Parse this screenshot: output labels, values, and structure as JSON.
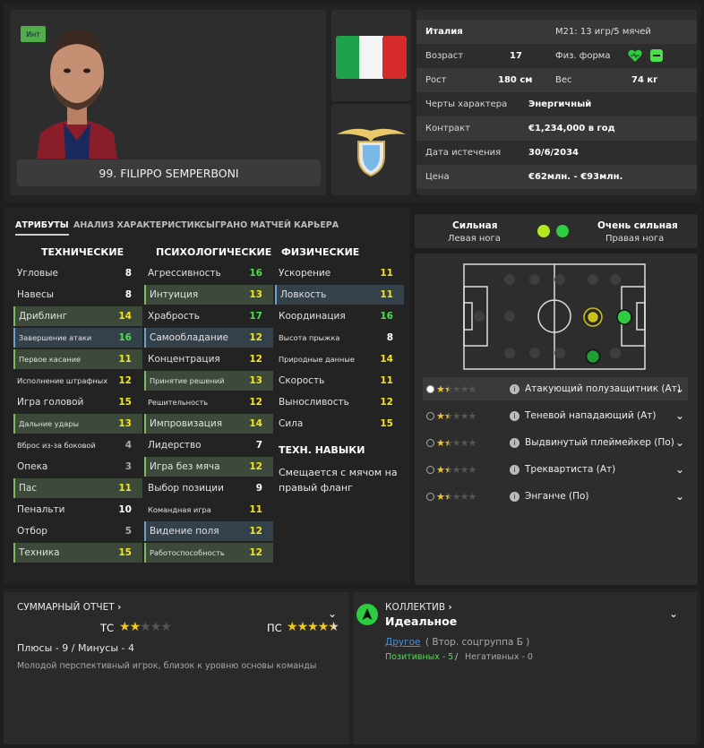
{
  "player": {
    "badge": "Инт",
    "name": "99. FILIPPO SEMPERBONI"
  },
  "info": {
    "nation": "Италия",
    "u21": "М21: 13 игр/5 мячей",
    "age_label": "Возраст",
    "age": "17",
    "fitness_label": "Физ. форма",
    "height_label": "Рост",
    "height": "180 см",
    "weight_label": "Вес",
    "weight": "74 кг",
    "trait_label": "Черты характера",
    "trait": "Энергичный",
    "contract_label": "Контракт",
    "contract": "€1,234,000 в год",
    "expiry_label": "Дата истечения",
    "expiry": "30/6/2034",
    "price_label": "Цена",
    "price": "€62млн. - €93млн."
  },
  "tabs": [
    "АТРИБУТЫ",
    "АНАЛИЗ ХАРАКТЕРИСТИК",
    "СЫГРАНО МАТЧЕЙ",
    "КАРЬЕРА"
  ],
  "columns": {
    "tech": "ТЕХНИЧЕСКИЕ",
    "psy": "ПСИХОЛОГИЧЕСКИЕ",
    "phys": "ФИЗИЧЕСКИЕ",
    "skills": "ТЕХН. НАВЫКИ"
  },
  "technical": [
    {
      "n": "Угловые",
      "v": "8"
    },
    {
      "n": "Навесы",
      "v": "8"
    },
    {
      "n": "Дриблинг",
      "v": "14"
    },
    {
      "n": "Завершение атаки",
      "v": "16"
    },
    {
      "n": "Первое касание",
      "v": "11"
    },
    {
      "n": "Исполнение штрафных",
      "v": "12"
    },
    {
      "n": "Игра головой",
      "v": "15"
    },
    {
      "n": "Дальние удары",
      "v": "13"
    },
    {
      "n": "Вброс из-за боковой",
      "v": "4"
    },
    {
      "n": "Опека",
      "v": "3"
    },
    {
      "n": "Пас",
      "v": "11"
    },
    {
      "n": "Пенальти",
      "v": "10"
    },
    {
      "n": "Отбор",
      "v": "5"
    },
    {
      "n": "Техника",
      "v": "15"
    }
  ],
  "mental": [
    {
      "n": "Агрессивность",
      "v": "16"
    },
    {
      "n": "Интуиция",
      "v": "13"
    },
    {
      "n": "Храбрость",
      "v": "17"
    },
    {
      "n": "Самообладание",
      "v": "12"
    },
    {
      "n": "Концентрация",
      "v": "12"
    },
    {
      "n": "Принятие решений",
      "v": "13"
    },
    {
      "n": "Решительность",
      "v": "12"
    },
    {
      "n": "Импровизация",
      "v": "14"
    },
    {
      "n": "Лидерство",
      "v": "7"
    },
    {
      "n": "Игра без мяча",
      "v": "12"
    },
    {
      "n": "Выбор позиции",
      "v": "9"
    },
    {
      "n": "Командная игра",
      "v": "11"
    },
    {
      "n": "Видение поля",
      "v": "12"
    },
    {
      "n": "Работоспособность",
      "v": "12"
    }
  ],
  "physical": [
    {
      "n": "Ускорение",
      "v": "11"
    },
    {
      "n": "Ловкость",
      "v": "11"
    },
    {
      "n": "Координация",
      "v": "16"
    },
    {
      "n": "Высота прыжка",
      "v": "8"
    },
    {
      "n": "Природные данные",
      "v": "14"
    },
    {
      "n": "Скорость",
      "v": "11"
    },
    {
      "n": "Выносливость",
      "v": "12"
    },
    {
      "n": "Сила",
      "v": "15"
    }
  ],
  "skill_text": "Смещается с мячом на правый фланг",
  "feet": {
    "left_strength": "Сильная",
    "left_label": "Левая нога",
    "right_strength": "Очень сильная",
    "right_label": "Правая нога"
  },
  "roles": [
    {
      "name": "Атакующий полузащитник (Ат)",
      "stars": 1.5
    },
    {
      "name": "Теневой нападающий (Ат)",
      "stars": 1.5
    },
    {
      "name": "Выдвинутый плеймейкер (По)",
      "stars": 1.5
    },
    {
      "name": "Треквартиста (Ат)",
      "stars": 1.5
    },
    {
      "name": "Энганче (По)",
      "stars": 1.5
    }
  ],
  "summary": {
    "title": "СУММАРНЫЙ ОТЧЕТ",
    "tc_label": "ТС",
    "tc_stars": 2,
    "pc_label": "ПС",
    "pc_stars": 4.5,
    "plus_minus": "Плюсы - 9 / Минусы - 4",
    "desc": "Молодой перспективный игрок, близок к уровню основы команды"
  },
  "collective": {
    "title": "КОЛЛЕКТИВ",
    "value": "Идеальное",
    "group_link": "Другое",
    "group_detail": "( Втор. соцгруппа Б )",
    "positive": "Позитивных - 5",
    "sep": "/",
    "negative": "Негативных - 0"
  },
  "colors": {
    "green": "#4be04b",
    "yellow": "#f2e61d",
    "accent": "#2ecc40"
  }
}
